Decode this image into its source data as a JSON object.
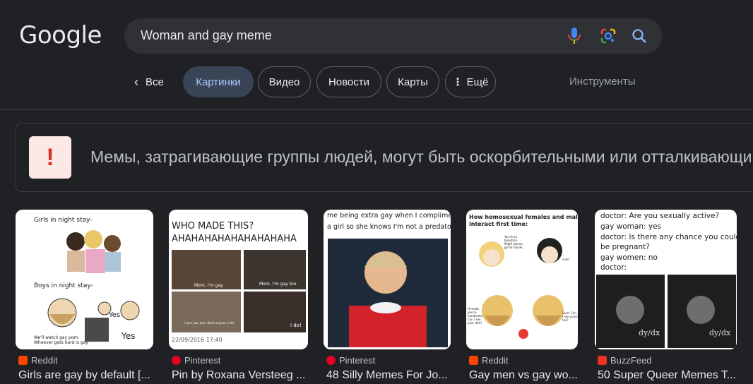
{
  "logo": {
    "text": "Google"
  },
  "search": {
    "query": "Woman and gay meme"
  },
  "tabs": [
    {
      "label": "Все"
    },
    {
      "label": "Картинки"
    },
    {
      "label": "Видео"
    },
    {
      "label": "Новости"
    },
    {
      "label": "Карты"
    },
    {
      "label": "Ещё"
    }
  ],
  "tools": {
    "label": "Инструменты"
  },
  "warning": {
    "icon_text": "!",
    "text": "Мемы, затрагивающие группы людей, могут быть оскорбительными или отталкивающими"
  },
  "results": [
    {
      "source": "Reddit",
      "title": "Girls are gay by default [...",
      "favicon": "reddit-icon",
      "thumb_text": [
        "Girls in night stay-",
        "Boys in night stay-",
        "Yes",
        "Yes",
        "We'll watch gay porn.",
        "Whoever gets hard is gay"
      ]
    },
    {
      "source": "Pinterest",
      "title": "Pin by Roxana Versteeg ...",
      "favicon": "pinterest-icon",
      "thumb_text": [
        "WHO MADE THIS?",
        "AHAHAHAHAHAHAHAHAHA",
        "Mom, I'm gay",
        "Mom, I'm gay too.",
        "I love you, but I don't anyone in this family like girls",
        "I do!",
        "22/09/2016 17:40"
      ]
    },
    {
      "source": "Pinterest",
      "title": "48 Silly Memes For Jo...",
      "favicon": "pinterest-icon",
      "thumb_text": [
        "me being extra gay when I compliment",
        "a girl so she knows I'm not a predator"
      ]
    },
    {
      "source": "Reddit",
      "title": "Gay men vs gay wo...",
      "favicon": "reddit-icon",
      "thumb_text": [
        "How homosexual females and males",
        "interact first time:",
        "You're so beautiful. Might wanna go for dinner..",
        "sure!",
        "Hi mate, you're handsome. Can I see your dick?",
        "Sure! Can I see yours too?"
      ]
    },
    {
      "source": "BuzzFeed",
      "title": "50 Super Queer Memes T...",
      "favicon": "buzzfeed-icon",
      "thumb_text": [
        "doctor: Are you sexually active?",
        "gay woman: yes",
        "doctor: Is there any chance you could",
        "be pregnant?",
        "gay women: no",
        "doctor:"
      ]
    }
  ],
  "colors": {
    "bg": "#202124",
    "active_tab_bg": "#394457",
    "active_tab_text": "#a8c7fa",
    "warning_icon": "#d93025"
  }
}
